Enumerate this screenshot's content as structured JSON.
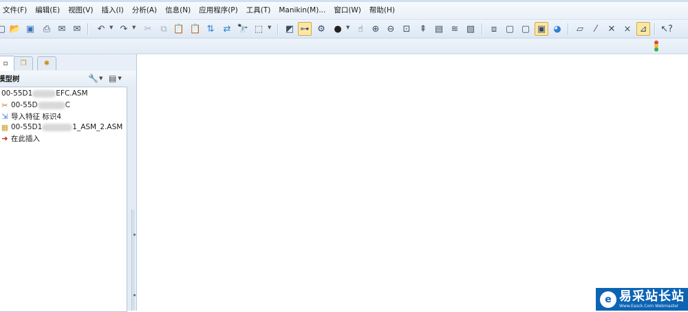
{
  "menubar": {
    "items": [
      "文件(F)",
      "编辑(E)",
      "视图(V)",
      "插入(I)",
      "分析(A)",
      "信息(N)",
      "应用程序(P)",
      "工具(T)",
      "Manikin(M)...",
      "窗口(W)",
      "帮助(H)"
    ]
  },
  "toolbar": {
    "icons": [
      "new-icon",
      "open-icon",
      "save-icon",
      "print-icon",
      "email-icon",
      "email-link-icon",
      "undo-icon",
      "redo-icon",
      "cut-icon",
      "copy-icon",
      "paste-icon",
      "paste-special-icon",
      "regenerate-icon",
      "regenerate-manager-icon",
      "find-icon",
      "select-box-icon",
      "refit-icon",
      "model-tree-icon",
      "layers-icon",
      "sphere-icon",
      "spin-center-icon",
      "zoom-in-icon",
      "zoom-out-icon",
      "zoom-fit-icon",
      "orient-icon",
      "saved-views-icon",
      "layer-icon",
      "appearance-icon",
      "wireframe-icon",
      "hidden-line-icon",
      "no-hidden-icon",
      "shading-icon",
      "enhanced-realism-icon",
      "datum-plane-icon",
      "datum-axis-icon",
      "datum-point-icon",
      "coordinate-system-icon",
      "annotation-icon",
      "help-icon"
    ]
  },
  "left_panel": {
    "tabs": [
      "model-tree-tab",
      "folder-browser-tab",
      "favorites-tab"
    ],
    "header_title": "模型树",
    "tree": [
      {
        "icon": "assembly-icon",
        "label_prefix": "00-55D1",
        "label_suffix": "EFC.ASM"
      },
      {
        "icon": "crossed-part-icon",
        "label_prefix": "00-55D",
        "label_suffix": "C"
      },
      {
        "icon": "import-feature-icon",
        "label_prefix": "导入特征",
        "label_suffix": "标识4"
      },
      {
        "icon": "sub-assembly-icon",
        "label_prefix": "00-55D1",
        "label_suffix": "1_ASM_2.ASM"
      },
      {
        "icon": "insert-here-arrow-icon",
        "label_prefix": "在此插入",
        "label_suffix": ""
      }
    ]
  },
  "watermark": {
    "main": "易采站长站",
    "sub": "Www.Easck.Com Webmaster"
  }
}
